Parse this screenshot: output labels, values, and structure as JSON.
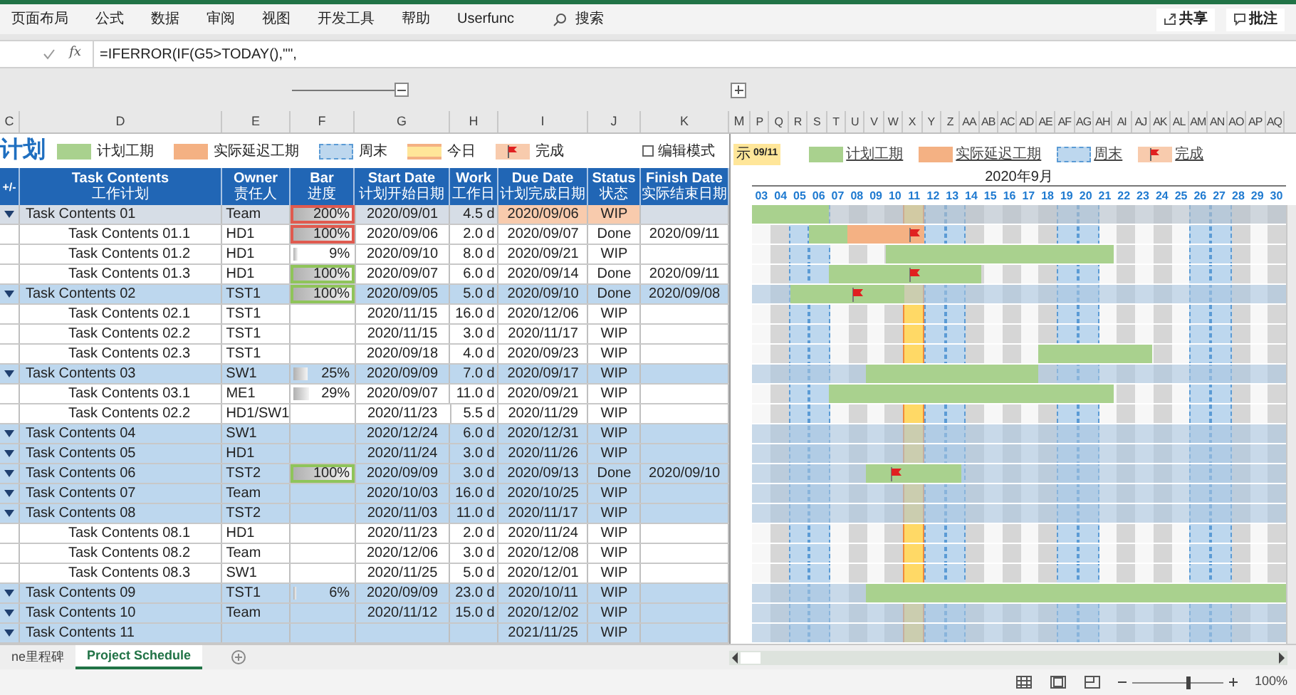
{
  "ribbon": {
    "tabs": [
      "页面布局",
      "公式",
      "数据",
      "审阅",
      "视图",
      "开发工具",
      "帮助",
      "Userfunc"
    ],
    "search": "搜索",
    "actions": [
      "共享",
      "批注"
    ]
  },
  "formula_bar": {
    "fx": "fx",
    "formula": "=IFERROR(IF(G5>TODAY(),\"\","
  },
  "column_letters": [
    "C",
    "D",
    "E",
    "F",
    "G",
    "H",
    "I",
    "J",
    "K"
  ],
  "gantt_letters": [
    "M",
    "P",
    "Q",
    "R",
    "S",
    "T",
    "U",
    "V",
    "W",
    "X",
    "Y",
    "Z",
    "AA",
    "AB",
    "AC",
    "AD",
    "AE",
    "AF",
    "AG",
    "AH",
    "AI",
    "AJ",
    "AK",
    "AL",
    "AM",
    "AN",
    "AO",
    "AP",
    "AQ"
  ],
  "title": "计划",
  "legend": [
    {
      "label": "计划工期",
      "kind": "plan"
    },
    {
      "label": "实际延迟工期",
      "kind": "delay"
    },
    {
      "label": "周末",
      "kind": "weekend"
    },
    {
      "label": "今日",
      "kind": "today"
    },
    {
      "label": "完成",
      "kind": "done"
    }
  ],
  "edit_mode": {
    "label": "编辑模式",
    "checked": false
  },
  "headers": [
    {
      "en": "+/-"
    },
    {
      "en": "Task Contents",
      "zh": "工作计划"
    },
    {
      "en": "Owner",
      "zh": "责任人"
    },
    {
      "en": "Bar",
      "zh": "进度"
    },
    {
      "en": "Start Date",
      "zh": "计划开始日期"
    },
    {
      "en": "Work",
      "zh": "工作日"
    },
    {
      "en": "Due Date",
      "zh": "计划完成日期"
    },
    {
      "en": "Status",
      "zh": "状态"
    },
    {
      "en": "Finish Date",
      "zh": "实际结束日期"
    }
  ],
  "gantt": {
    "today_label": "示",
    "today_date": "09/11",
    "legend": [
      {
        "label": "计划工期",
        "kind": "plan"
      },
      {
        "label": "实际延迟工期",
        "kind": "delay"
      },
      {
        "label": "周末",
        "kind": "weekend"
      },
      {
        "label": "完成",
        "kind": "done"
      }
    ],
    "month": "2020年9月",
    "days": [
      {
        "label": "03",
        "weekend": false,
        "today": false
      },
      {
        "label": "04",
        "weekend": false,
        "today": false
      },
      {
        "label": "05",
        "weekend": true,
        "today": false
      },
      {
        "label": "06",
        "weekend": true,
        "today": false
      },
      {
        "label": "07",
        "weekend": false,
        "today": false
      },
      {
        "label": "08",
        "weekend": false,
        "today": false
      },
      {
        "label": "09",
        "weekend": false,
        "today": false
      },
      {
        "label": "10",
        "weekend": false,
        "today": false
      },
      {
        "label": "11",
        "weekend": false,
        "today": true
      },
      {
        "label": "12",
        "weekend": true,
        "today": false
      },
      {
        "label": "13",
        "weekend": true,
        "today": false
      },
      {
        "label": "14",
        "weekend": false,
        "today": false
      },
      {
        "label": "15",
        "weekend": false,
        "today": false
      },
      {
        "label": "16",
        "weekend": false,
        "today": false
      },
      {
        "label": "17",
        "weekend": false,
        "today": false
      },
      {
        "label": "18",
        "weekend": false,
        "today": false
      },
      {
        "label": "19",
        "weekend": true,
        "today": false
      },
      {
        "label": "20",
        "weekend": true,
        "today": false
      },
      {
        "label": "21",
        "weekend": false,
        "today": false
      },
      {
        "label": "22",
        "weekend": false,
        "today": false
      },
      {
        "label": "23",
        "weekend": false,
        "today": false
      },
      {
        "label": "24",
        "weekend": false,
        "today": false
      },
      {
        "label": "25",
        "weekend": false,
        "today": false
      },
      {
        "label": "26",
        "weekend": true,
        "today": false
      },
      {
        "label": "27",
        "weekend": true,
        "today": false
      },
      {
        "label": "28",
        "weekend": false,
        "today": false
      },
      {
        "label": "29",
        "weekend": false,
        "today": false
      },
      {
        "label": "30",
        "weekend": false,
        "today": false
      }
    ]
  },
  "rows": [
    {
      "kind": "summary",
      "selected": true,
      "late": true,
      "name": "Task Contents 01",
      "owner": "Team",
      "bar": {
        "text": "200%",
        "level": 1,
        "kind": "late"
      },
      "start": "2020/09/01",
      "work": "4.5 d",
      "due": "2020/09/06",
      "status": "WIP",
      "cells": [
        {
          "kind": "plan"
        },
        {
          "kind": "plan"
        },
        {
          "kind": "plan"
        },
        {
          "kind": "plan"
        },
        {
          "kind": "none"
        },
        {
          "kind": "none"
        },
        {
          "kind": "none"
        },
        {
          "kind": "none"
        },
        {
          "kind": "none"
        },
        {
          "kind": "none"
        },
        {
          "kind": "none"
        },
        {
          "kind": "none"
        },
        {
          "kind": "none"
        },
        {
          "kind": "none"
        },
        {
          "kind": "none"
        },
        {
          "kind": "none"
        },
        {
          "kind": "none"
        },
        {
          "kind": "none"
        },
        {
          "kind": "none"
        },
        {
          "kind": "none"
        },
        {
          "kind": "none"
        },
        {
          "kind": "none"
        },
        {
          "kind": "none"
        },
        {
          "kind": "none"
        },
        {
          "kind": "none"
        },
        {
          "kind": "none"
        },
        {
          "kind": "none"
        },
        {
          "kind": "none"
        }
      ]
    },
    {
      "kind": "task",
      "selected": false,
      "late": false,
      "name": "Task Contents 01.1",
      "owner": "HD1",
      "bar": {
        "text": "100%",
        "level": 1,
        "kind": "late"
      },
      "start": "2020/09/06",
      "work": "2.0 d",
      "due": "2020/09/07",
      "status": "Done",
      "finish": "2020/09/11",
      "cells": [
        {
          "kind": "none"
        },
        {
          "kind": "none"
        },
        {
          "kind": "none"
        },
        {
          "kind": "plan"
        },
        {
          "kind": "plan"
        },
        {
          "kind": "delay"
        },
        {
          "kind": "delay"
        },
        {
          "kind": "delay"
        },
        {
          "kind": "delay_done"
        },
        {
          "kind": "none"
        },
        {
          "kind": "none"
        },
        {
          "kind": "none"
        },
        {
          "kind": "none"
        },
        {
          "kind": "none"
        },
        {
          "kind": "none"
        },
        {
          "kind": "none"
        },
        {
          "kind": "none"
        },
        {
          "kind": "none"
        },
        {
          "kind": "none"
        },
        {
          "kind": "none"
        },
        {
          "kind": "none"
        },
        {
          "kind": "none"
        },
        {
          "kind": "none"
        },
        {
          "kind": "none"
        },
        {
          "kind": "none"
        },
        {
          "kind": "none"
        },
        {
          "kind": "none"
        },
        {
          "kind": "none"
        }
      ]
    },
    {
      "kind": "task",
      "selected": false,
      "late": false,
      "name": "Task Contents 01.2",
      "owner": "HD1",
      "bar": {
        "text": "9%",
        "level": 0.09,
        "kind": "plain"
      },
      "start": "2020/09/10",
      "work": "8.0 d",
      "due": "2020/09/21",
      "status": "WIP",
      "cells": [
        {
          "kind": "none"
        },
        {
          "kind": "none"
        },
        {
          "kind": "none"
        },
        {
          "kind": "none"
        },
        {
          "kind": "none"
        },
        {
          "kind": "none"
        },
        {
          "kind": "none"
        },
        {
          "kind": "plan"
        },
        {
          "kind": "plan"
        },
        {
          "kind": "plan"
        },
        {
          "kind": "plan"
        },
        {
          "kind": "plan"
        },
        {
          "kind": "plan"
        },
        {
          "kind": "plan"
        },
        {
          "kind": "plan"
        },
        {
          "kind": "plan"
        },
        {
          "kind": "plan"
        },
        {
          "kind": "plan"
        },
        {
          "kind": "plan"
        },
        {
          "kind": "none"
        },
        {
          "kind": "none"
        },
        {
          "kind": "none"
        },
        {
          "kind": "none"
        },
        {
          "kind": "none"
        },
        {
          "kind": "none"
        },
        {
          "kind": "none"
        },
        {
          "kind": "none"
        },
        {
          "kind": "none"
        }
      ]
    },
    {
      "kind": "task",
      "selected": false,
      "late": false,
      "name": "Task Contents 01.3",
      "owner": "HD1",
      "bar": {
        "text": "100%",
        "level": 1,
        "kind": "done"
      },
      "start": "2020/09/07",
      "work": "6.0 d",
      "due": "2020/09/14",
      "status": "Done",
      "finish": "2020/09/11",
      "cells": [
        {
          "kind": "none"
        },
        {
          "kind": "none"
        },
        {
          "kind": "none"
        },
        {
          "kind": "none"
        },
        {
          "kind": "plan"
        },
        {
          "kind": "plan"
        },
        {
          "kind": "plan"
        },
        {
          "kind": "plan"
        },
        {
          "kind": "plan_done"
        },
        {
          "kind": "plan"
        },
        {
          "kind": "plan"
        },
        {
          "kind": "plan"
        },
        {
          "kind": "none"
        },
        {
          "kind": "none"
        },
        {
          "kind": "none"
        },
        {
          "kind": "none"
        },
        {
          "kind": "none"
        },
        {
          "kind": "none"
        },
        {
          "kind": "none"
        },
        {
          "kind": "none"
        },
        {
          "kind": "none"
        },
        {
          "kind": "none"
        },
        {
          "kind": "none"
        },
        {
          "kind": "none"
        },
        {
          "kind": "none"
        },
        {
          "kind": "none"
        },
        {
          "kind": "none"
        },
        {
          "kind": "none"
        }
      ]
    },
    {
      "kind": "summary",
      "selected": false,
      "late": false,
      "name": "Task Contents 02",
      "owner": "TST1",
      "bar": {
        "text": "100%",
        "level": 1,
        "kind": "done"
      },
      "start": "2020/09/05",
      "work": "5.0 d",
      "due": "2020/09/10",
      "status": "Done",
      "finish": "2020/09/08",
      "cells": [
        {
          "kind": "none"
        },
        {
          "kind": "none"
        },
        {
          "kind": "plan"
        },
        {
          "kind": "plan"
        },
        {
          "kind": "plan"
        },
        {
          "kind": "plan_done"
        },
        {
          "kind": "plan"
        },
        {
          "kind": "plan"
        },
        {
          "kind": "none"
        },
        {
          "kind": "none"
        },
        {
          "kind": "none"
        },
        {
          "kind": "none"
        },
        {
          "kind": "none"
        },
        {
          "kind": "none"
        },
        {
          "kind": "none"
        },
        {
          "kind": "none"
        },
        {
          "kind": "none"
        },
        {
          "kind": "none"
        },
        {
          "kind": "none"
        },
        {
          "kind": "none"
        },
        {
          "kind": "none"
        },
        {
          "kind": "none"
        },
        {
          "kind": "none"
        },
        {
          "kind": "none"
        },
        {
          "kind": "none"
        },
        {
          "kind": "none"
        },
        {
          "kind": "none"
        },
        {
          "kind": "none"
        }
      ]
    },
    {
      "kind": "task",
      "selected": false,
      "late": false,
      "name": "Task Contents 02.1",
      "owner": "TST1",
      "start": "2020/11/15",
      "work": "16.0 d",
      "due": "2020/12/06",
      "status": "WIP"
    },
    {
      "kind": "task",
      "selected": false,
      "late": false,
      "name": "Task Contents 02.2",
      "owner": "TST1",
      "start": "2020/11/15",
      "work": "3.0 d",
      "due": "2020/11/17",
      "status": "WIP"
    },
    {
      "kind": "task",
      "selected": false,
      "late": false,
      "name": "Task Contents 02.3",
      "owner": "TST1",
      "start": "2020/09/18",
      "work": "4.0 d",
      "due": "2020/09/23",
      "status": "WIP",
      "cells": [
        {
          "kind": "none"
        },
        {
          "kind": "none"
        },
        {
          "kind": "none"
        },
        {
          "kind": "none"
        },
        {
          "kind": "none"
        },
        {
          "kind": "none"
        },
        {
          "kind": "none"
        },
        {
          "kind": "none"
        },
        {
          "kind": "none"
        },
        {
          "kind": "none"
        },
        {
          "kind": "none"
        },
        {
          "kind": "none"
        },
        {
          "kind": "none"
        },
        {
          "kind": "none"
        },
        {
          "kind": "none"
        },
        {
          "kind": "plan"
        },
        {
          "kind": "plan"
        },
        {
          "kind": "plan"
        },
        {
          "kind": "plan"
        },
        {
          "kind": "plan"
        },
        {
          "kind": "plan"
        },
        {
          "kind": "none"
        },
        {
          "kind": "none"
        },
        {
          "kind": "none"
        },
        {
          "kind": "none"
        },
        {
          "kind": "none"
        },
        {
          "kind": "none"
        },
        {
          "kind": "none"
        }
      ]
    },
    {
      "kind": "summary",
      "selected": false,
      "late": false,
      "name": "Task Contents 03",
      "owner": "SW1",
      "bar": {
        "text": "25%",
        "level": 0.25,
        "kind": "plain"
      },
      "start": "2020/09/09",
      "work": "7.0 d",
      "due": "2020/09/17",
      "status": "WIP",
      "cells": [
        {
          "kind": "none"
        },
        {
          "kind": "none"
        },
        {
          "kind": "none"
        },
        {
          "kind": "none"
        },
        {
          "kind": "none"
        },
        {
          "kind": "none"
        },
        {
          "kind": "plan"
        },
        {
          "kind": "plan"
        },
        {
          "kind": "plan"
        },
        {
          "kind": "plan"
        },
        {
          "kind": "plan"
        },
        {
          "kind": "plan"
        },
        {
          "kind": "plan"
        },
        {
          "kind": "plan"
        },
        {
          "kind": "plan"
        },
        {
          "kind": "none"
        },
        {
          "kind": "none"
        },
        {
          "kind": "none"
        },
        {
          "kind": "none"
        },
        {
          "kind": "none"
        },
        {
          "kind": "none"
        },
        {
          "kind": "none"
        },
        {
          "kind": "none"
        },
        {
          "kind": "none"
        },
        {
          "kind": "none"
        },
        {
          "kind": "none"
        },
        {
          "kind": "none"
        },
        {
          "kind": "none"
        }
      ]
    },
    {
      "kind": "task",
      "selected": false,
      "late": false,
      "name": "Task Contents 03.1",
      "owner": "ME1",
      "bar": {
        "text": "29%",
        "level": 0.29,
        "kind": "plain"
      },
      "start": "2020/09/07",
      "work": "11.0 d",
      "due": "2020/09/21",
      "status": "WIP",
      "cells": [
        {
          "kind": "none"
        },
        {
          "kind": "none"
        },
        {
          "kind": "none"
        },
        {
          "kind": "none"
        },
        {
          "kind": "plan"
        },
        {
          "kind": "plan"
        },
        {
          "kind": "plan"
        },
        {
          "kind": "plan"
        },
        {
          "kind": "plan"
        },
        {
          "kind": "plan"
        },
        {
          "kind": "plan"
        },
        {
          "kind": "plan"
        },
        {
          "kind": "plan"
        },
        {
          "kind": "plan"
        },
        {
          "kind": "plan"
        },
        {
          "kind": "plan"
        },
        {
          "kind": "plan"
        },
        {
          "kind": "plan"
        },
        {
          "kind": "plan"
        },
        {
          "kind": "none"
        },
        {
          "kind": "none"
        },
        {
          "kind": "none"
        },
        {
          "kind": "none"
        },
        {
          "kind": "none"
        },
        {
          "kind": "none"
        },
        {
          "kind": "none"
        },
        {
          "kind": "none"
        },
        {
          "kind": "none"
        }
      ]
    },
    {
      "kind": "task",
      "selected": false,
      "late": false,
      "name": "Task Contents 02.2",
      "owner": "HD1/SW1",
      "start": "2020/11/23",
      "work": "5.5 d",
      "due": "2020/11/29",
      "status": "WIP"
    },
    {
      "kind": "summary",
      "selected": false,
      "late": false,
      "name": "Task Contents 04",
      "owner": "SW1",
      "start": "2020/12/24",
      "work": "6.0 d",
      "due": "2020/12/31",
      "status": "WIP"
    },
    {
      "kind": "summary",
      "selected": false,
      "late": false,
      "name": "Task Contents 05",
      "owner": "HD1",
      "start": "2020/11/24",
      "work": "3.0 d",
      "due": "2020/11/26",
      "status": "WIP"
    },
    {
      "kind": "summary",
      "selected": false,
      "late": false,
      "name": "Task Contents 06",
      "owner": "TST2",
      "bar": {
        "text": "100%",
        "level": 1,
        "kind": "done"
      },
      "start": "2020/09/09",
      "work": "3.0 d",
      "due": "2020/09/13",
      "status": "Done",
      "finish": "2020/09/10",
      "cells": [
        {
          "kind": "none"
        },
        {
          "kind": "none"
        },
        {
          "kind": "none"
        },
        {
          "kind": "none"
        },
        {
          "kind": "none"
        },
        {
          "kind": "none"
        },
        {
          "kind": "plan"
        },
        {
          "kind": "plan_done"
        },
        {
          "kind": "plan"
        },
        {
          "kind": "plan"
        },
        {
          "kind": "plan"
        },
        {
          "kind": "none"
        },
        {
          "kind": "none"
        },
        {
          "kind": "none"
        },
        {
          "kind": "none"
        },
        {
          "kind": "none"
        },
        {
          "kind": "none"
        },
        {
          "kind": "none"
        },
        {
          "kind": "none"
        },
        {
          "kind": "none"
        },
        {
          "kind": "none"
        },
        {
          "kind": "none"
        },
        {
          "kind": "none"
        },
        {
          "kind": "none"
        },
        {
          "kind": "none"
        },
        {
          "kind": "none"
        },
        {
          "kind": "none"
        },
        {
          "kind": "none"
        }
      ]
    },
    {
      "kind": "summary",
      "selected": false,
      "late": false,
      "name": "Task Contents 07",
      "owner": "Team",
      "start": "2020/10/03",
      "work": "16.0 d",
      "due": "2020/10/25",
      "status": "WIP"
    },
    {
      "kind": "summary",
      "selected": false,
      "late": false,
      "name": "Task Contents 08",
      "owner": "TST2",
      "start": "2020/11/03",
      "work": "11.0 d",
      "due": "2020/11/17",
      "status": "WIP"
    },
    {
      "kind": "task",
      "selected": false,
      "late": false,
      "name": "Task Contents 08.1",
      "owner": "HD1",
      "start": "2020/11/23",
      "work": "2.0 d",
      "due": "2020/11/24",
      "status": "WIP"
    },
    {
      "kind": "task",
      "selected": false,
      "late": false,
      "name": "Task Contents 08.2",
      "owner": "Team",
      "start": "2020/12/06",
      "work": "3.0 d",
      "due": "2020/12/08",
      "status": "WIP"
    },
    {
      "kind": "task",
      "selected": false,
      "late": false,
      "name": "Task Contents 08.3",
      "owner": "SW1",
      "start": "2020/11/25",
      "work": "5.0 d",
      "due": "2020/12/01",
      "status": "WIP"
    },
    {
      "kind": "summary",
      "selected": false,
      "late": false,
      "name": "Task Contents 09",
      "owner": "TST1",
      "bar": {
        "text": "6%",
        "level": 0.06,
        "kind": "plain"
      },
      "start": "2020/09/09",
      "work": "23.0 d",
      "due": "2020/10/11",
      "status": "WIP",
      "cells": [
        {
          "kind": "none"
        },
        {
          "kind": "none"
        },
        {
          "kind": "none"
        },
        {
          "kind": "none"
        },
        {
          "kind": "none"
        },
        {
          "kind": "none"
        },
        {
          "kind": "plan"
        },
        {
          "kind": "plan"
        },
        {
          "kind": "plan"
        },
        {
          "kind": "plan"
        },
        {
          "kind": "plan"
        },
        {
          "kind": "plan"
        },
        {
          "kind": "plan"
        },
        {
          "kind": "plan"
        },
        {
          "kind": "plan"
        },
        {
          "kind": "plan"
        },
        {
          "kind": "plan"
        },
        {
          "kind": "plan"
        },
        {
          "kind": "plan"
        },
        {
          "kind": "plan"
        },
        {
          "kind": "plan"
        },
        {
          "kind": "plan"
        },
        {
          "kind": "plan"
        },
        {
          "kind": "plan"
        },
        {
          "kind": "plan"
        },
        {
          "kind": "plan"
        },
        {
          "kind": "plan"
        },
        {
          "kind": "plan"
        }
      ]
    },
    {
      "kind": "summary",
      "selected": false,
      "late": false,
      "name": "Task Contents 10",
      "owner": "Team",
      "start": "2020/11/12",
      "work": "15.0 d",
      "due": "2020/12/02",
      "status": "WIP"
    },
    {
      "kind": "summary",
      "selected": false,
      "late": false,
      "name": "Task Contents 11",
      "due": "2021/11/25",
      "status": "WIP"
    }
  ],
  "sheet_tabs": [
    {
      "label": "ne里程碑",
      "selected": false
    },
    {
      "label": "Project Schedule",
      "selected": true
    }
  ],
  "status_bar": {
    "zoom": "100%",
    "level": 0.6
  }
}
